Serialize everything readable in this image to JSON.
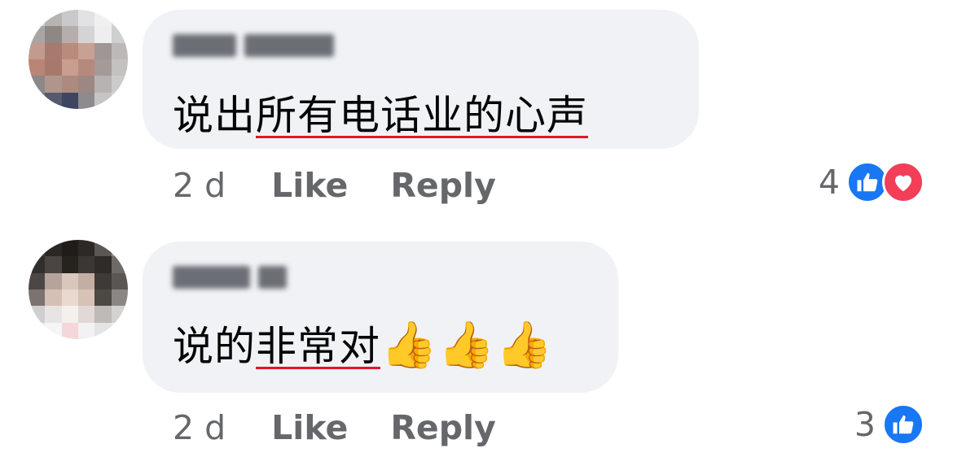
{
  "comments": [
    {
      "text_plain": "说出",
      "text_underlined": "所有电话业的心声",
      "time": "2 d",
      "like_label": "Like",
      "reply_label": "Reply",
      "reaction_count": "4",
      "reactions": [
        "like-icon",
        "love-icon"
      ]
    },
    {
      "text_plain": "说的",
      "text_underlined": "非常对",
      "emoji": "👍👍👍",
      "time": "2 d",
      "like_label": "Like",
      "reply_label": "Reply",
      "reaction_count": "3",
      "reactions": [
        "like-icon"
      ]
    }
  ],
  "colors": {
    "bubble_bg": "#f0f2f5",
    "meta_text": "#65676b",
    "like_blue": "#1877f2",
    "love_red": "#f33e58",
    "spellcheck_underline": "#e4142a"
  }
}
